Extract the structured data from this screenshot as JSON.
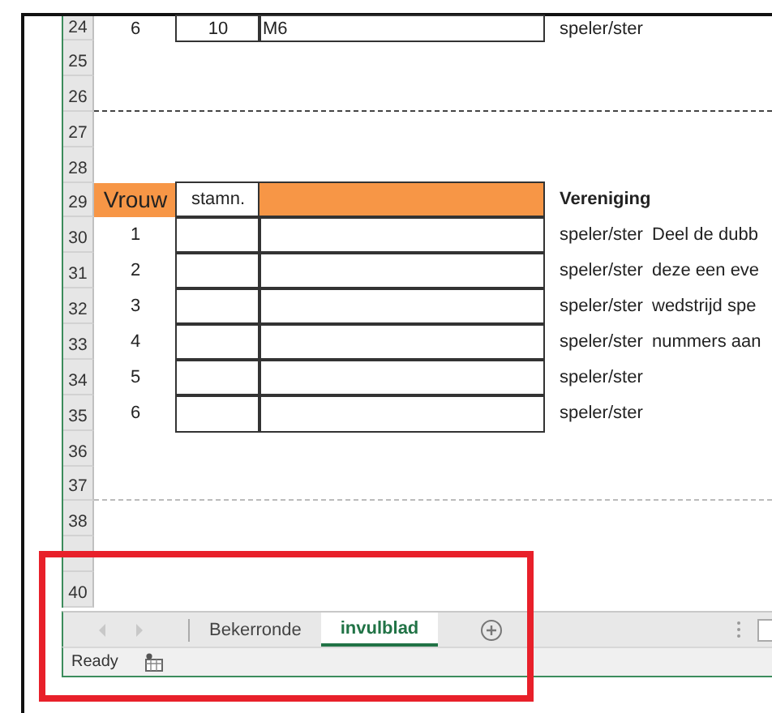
{
  "sheet": {
    "rows": [
      {
        "number": "24",
        "kind": "entry",
        "a": "6",
        "b": "10",
        "c": "M6",
        "d": "speler/ster"
      },
      {
        "number": "25",
        "kind": "blank"
      },
      {
        "number": "26",
        "manual_page_break": true
      },
      {
        "number": "27",
        "kind": "blank"
      },
      {
        "number": "28",
        "kind": "blank"
      },
      {
        "number": "29",
        "kind": "header",
        "a": "Vrouw",
        "b": "stamn.",
        "d": "Vereniging"
      },
      {
        "number": "30",
        "kind": "entry",
        "a": "1",
        "d": "speler/ster",
        "e": "Deel de dubb"
      },
      {
        "number": "31",
        "kind": "entry",
        "a": "2",
        "d": "speler/ster",
        "e": "deze een eve"
      },
      {
        "number": "32",
        "kind": "entry",
        "a": "3",
        "d": "speler/ster",
        "e": "wedstrijd spe"
      },
      {
        "number": "33",
        "kind": "entry",
        "a": "4",
        "d": "speler/ster",
        "e": "nummers aan"
      },
      {
        "number": "34",
        "kind": "entry",
        "a": "5",
        "d": "speler/ster"
      },
      {
        "number": "35",
        "kind": "entry",
        "a": "6",
        "d": "speler/ster"
      },
      {
        "number": "36",
        "kind": "blank"
      },
      {
        "number": "37",
        "auto_page_break": true
      },
      {
        "number": "38",
        "kind": "blank"
      },
      {
        "kind": "blank"
      },
      {
        "number": "40",
        "kind": "blank"
      }
    ]
  },
  "sheet_tabs": [
    {
      "label": "Bekerronde",
      "selected": false
    },
    {
      "label": "invulblad",
      "selected": true
    }
  ],
  "status_bar": {
    "text": "Ready"
  }
}
